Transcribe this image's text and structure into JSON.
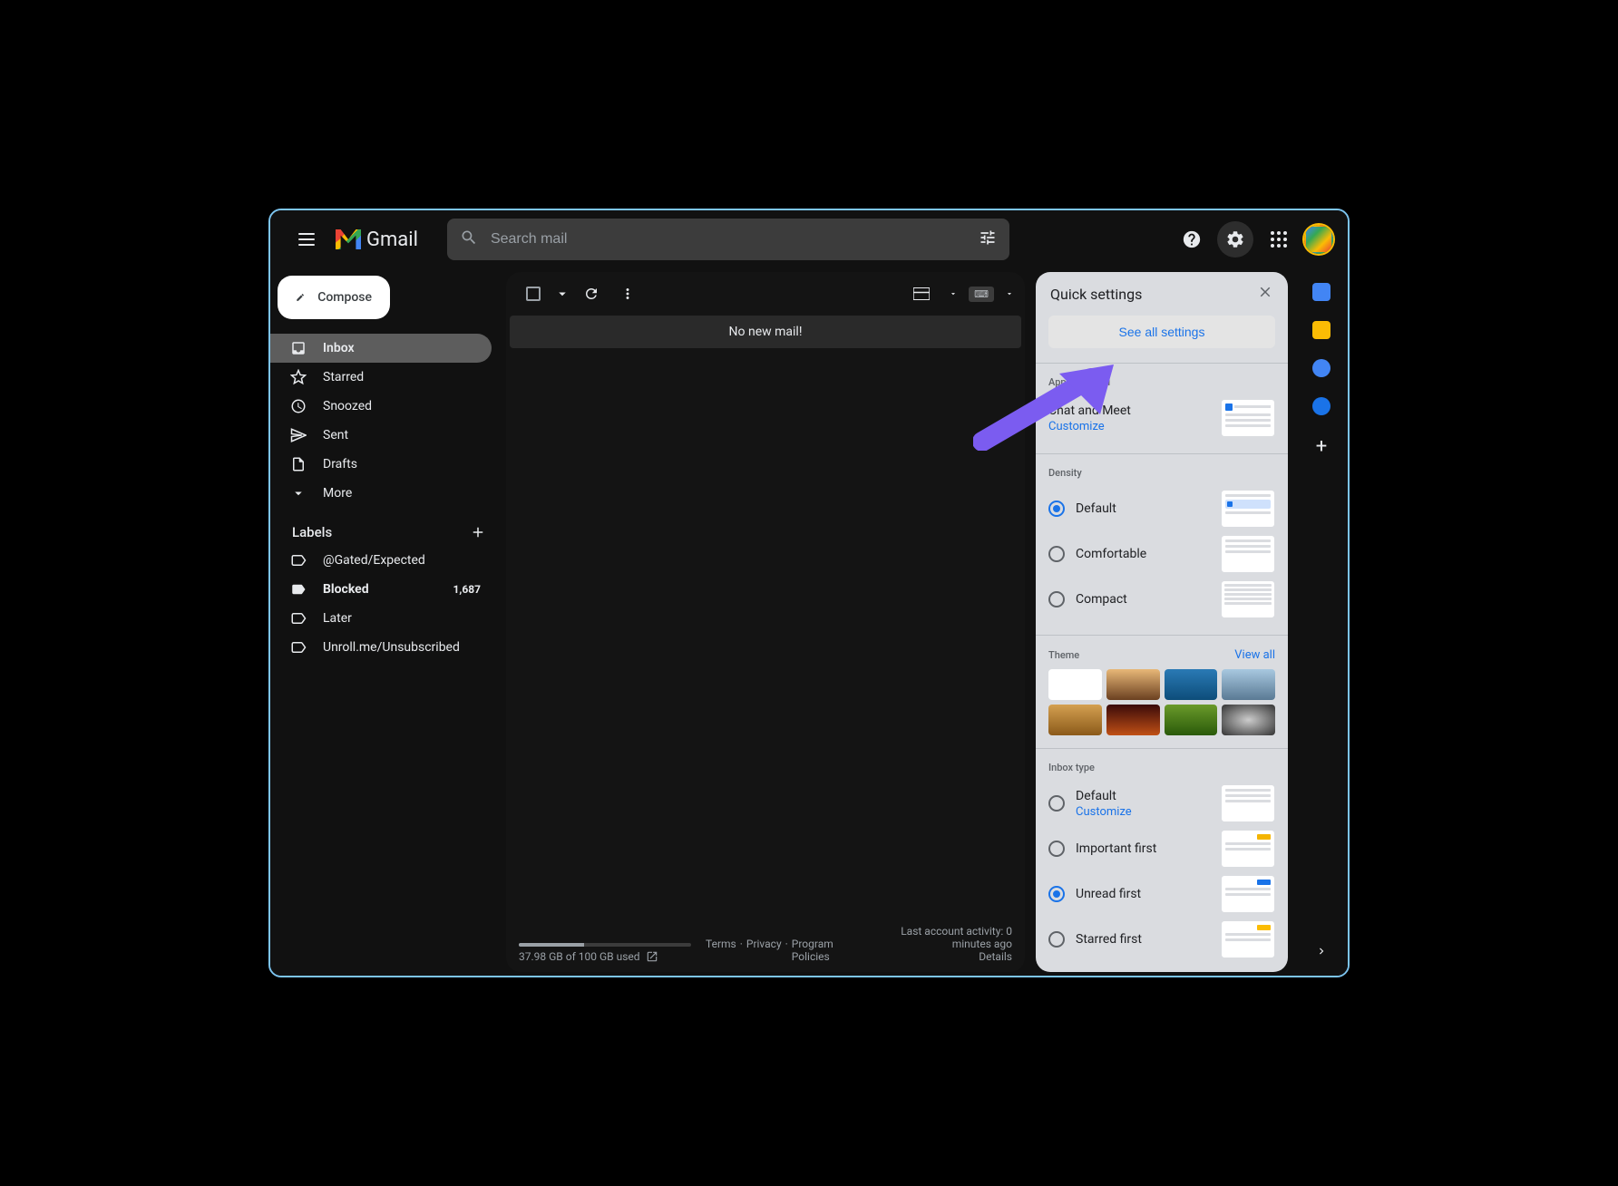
{
  "header": {
    "app_name": "Gmail",
    "search_placeholder": "Search mail"
  },
  "compose": "Compose",
  "nav": [
    {
      "label": "Inbox"
    },
    {
      "label": "Starred"
    },
    {
      "label": "Snoozed"
    },
    {
      "label": "Sent"
    },
    {
      "label": "Drafts"
    },
    {
      "label": "More"
    }
  ],
  "labels_title": "Labels",
  "labels": [
    {
      "label": "@Gated/Expected",
      "count": ""
    },
    {
      "label": "Blocked",
      "count": "1,687",
      "bold": true
    },
    {
      "label": "Later",
      "count": ""
    },
    {
      "label": "Unroll.me/Unsubscribed",
      "count": ""
    }
  ],
  "mail": {
    "empty": "No new mail!",
    "storage": "37.98 GB of 100 GB used",
    "terms": "Terms",
    "privacy": "Privacy",
    "program": "Program Policies",
    "activity": "Last account activity: 0 minutes ago",
    "details": "Details"
  },
  "qs": {
    "title": "Quick settings",
    "see_all": "See all settings",
    "apps_title": "Apps in Gmail",
    "chat_meet": "Chat and Meet",
    "customize": "Customize",
    "density_title": "Density",
    "density": [
      "Default",
      "Comfortable",
      "Compact"
    ],
    "theme_title": "Theme",
    "view_all": "View all",
    "inbox_title": "Inbox type",
    "inbox": [
      "Default",
      "Important first",
      "Unread first",
      "Starred first"
    ]
  }
}
